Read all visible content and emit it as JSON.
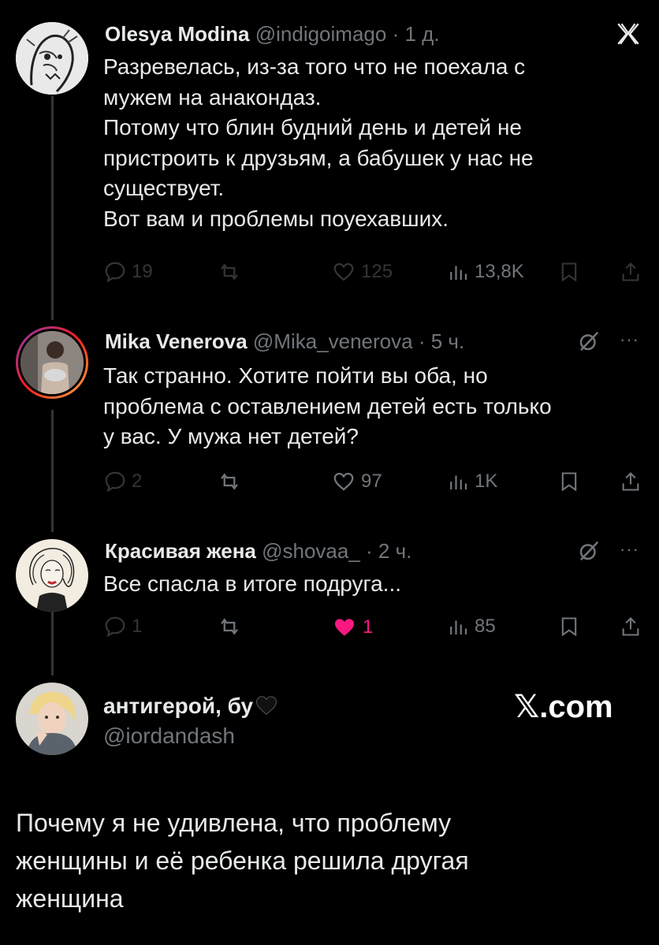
{
  "tweets": [
    {
      "name": "Olesya Modina",
      "handle": "@indigoimago",
      "time": "· 1 д.",
      "lines": [
        "Разревелась, из-за того что не поехала с",
        "мужем на анакондаз.",
        "Потому что блин будний день и детей не",
        "пристроить к друзьям, а бабушек у нас не",
        "существует.",
        "Вот вам и проблемы поуехавших."
      ],
      "replies": "19",
      "reposts": "",
      "likes": "125",
      "views": "13,8K",
      "liked": false
    },
    {
      "name": "Mika Venerova",
      "handle": "@Mika_venerova",
      "time": "· 5 ч.",
      "lines": [
        "Так странно. Хотите пойти вы оба, но",
        "проблема с оставлением детей есть только",
        "у вас. У мужа нет детей?"
      ],
      "replies": "2",
      "reposts": "",
      "likes": "97",
      "views": "1K",
      "liked": false
    },
    {
      "name": "Красивая жена",
      "handle": "@shovaa_",
      "time": "· 2 ч.",
      "lines": [
        "Все спасла в итоге подруга..."
      ],
      "replies": "1",
      "reposts": "",
      "likes": "1",
      "views": "85",
      "liked": true
    }
  ],
  "quote": {
    "name": "антигерой, бу",
    "handle": "@iordandash",
    "watermark": "𝕏.com",
    "lines": [
      "Почему я не удивлена, что проблему",
      "женщины и её ребенка решила другая",
      "женщина"
    ]
  },
  "icons": {
    "top_right": "x-logo-icon",
    "grok": "grok-icon",
    "more": "more-icon"
  },
  "colors": {
    "background": "#000000",
    "text": "#e7e9ea",
    "muted": "#71767b",
    "like_active": "#f91880",
    "thread_line": "#333639"
  }
}
